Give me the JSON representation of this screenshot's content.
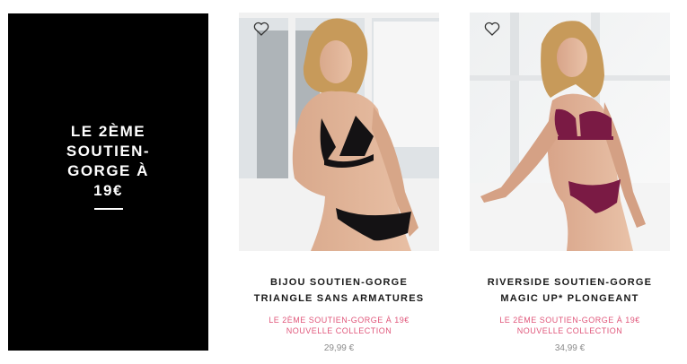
{
  "promo_banner": {
    "text": "LE 2ÈME SOUTIEN-GORGE À 19€"
  },
  "products": [
    {
      "name_line1": "BIJOU SOUTIEN-GORGE",
      "name_line2": "TRIANGLE SANS ARMATURES",
      "promo_line1": "LE 2ÈME SOUTIEN-GORGE À 19€",
      "promo_line2": "NOUVELLE COLLECTION",
      "price": "29,99 €",
      "garment_color": "#141214"
    },
    {
      "name_line1": "RIVERSIDE SOUTIEN-GORGE",
      "name_line2": "MAGIC UP* PLONGEANT",
      "promo_line1": "LE 2ÈME SOUTIEN-GORGE À 19€",
      "promo_line2": "NOUVELLE COLLECTION",
      "price": "34,99 €",
      "garment_color": "#7a1a44"
    }
  ],
  "icons": {
    "wishlist": "heart-outline-icon"
  },
  "colors": {
    "accent_pink": "#e0567a",
    "banner_bg": "#000000",
    "price_grey": "#8a8a8a"
  }
}
